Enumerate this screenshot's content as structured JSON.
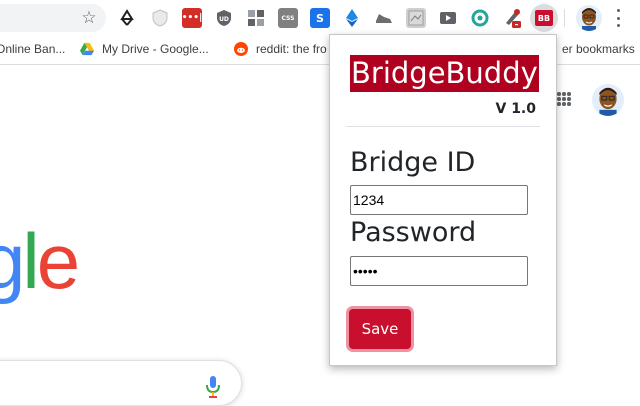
{
  "toolbar": {
    "star_icon": "star-icon",
    "extensions": [
      {
        "name": "recycle-extension-icon"
      },
      {
        "name": "shield-extension-icon"
      },
      {
        "name": "lastpass-extension-icon"
      },
      {
        "name": "ublock-extension-icon",
        "text": "UD"
      },
      {
        "name": "grid-extension-icon"
      },
      {
        "name": "css-extension-icon",
        "text": "CSS"
      },
      {
        "name": "s-extension-icon",
        "text": "S"
      },
      {
        "name": "ethereum-extension-icon"
      },
      {
        "name": "shoe-extension-icon"
      },
      {
        "name": "screenshot-extension-icon"
      },
      {
        "name": "youtube-extension-icon"
      },
      {
        "name": "circle-extension-icon"
      },
      {
        "name": "eyedropper-extension-icon"
      }
    ],
    "active_extension_label": "BB"
  },
  "bookmarks": [
    {
      "label": "Online Ban...",
      "icon": "bank-icon"
    },
    {
      "label": "My Drive - Google...",
      "icon": "google-drive-icon"
    },
    {
      "label": "reddit: the fro",
      "icon": "reddit-icon"
    },
    {
      "label": "er bookmarks",
      "icon": "folder-icon"
    }
  ],
  "google": {
    "logo_g": "g",
    "logo_l": "l",
    "logo_e": "e"
  },
  "popup": {
    "brand": "BridgeBuddy",
    "version": "V 1.0",
    "bridge_id_label": "Bridge ID",
    "bridge_id_value": "1234",
    "password_label": "Password",
    "password_value": "•••••",
    "save_label": "Save"
  },
  "colors": {
    "brand": "#b00020",
    "save_button": "#c8102e"
  }
}
